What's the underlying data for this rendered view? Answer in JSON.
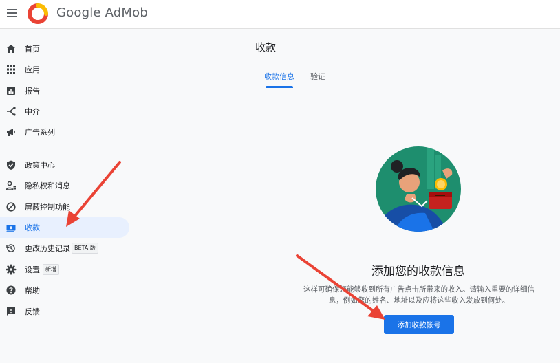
{
  "header": {
    "brand": "Google AdMob",
    "menu_icon": "hamburger-menu-icon",
    "logo_icon": "admob-logo-icon"
  },
  "sidebar": {
    "items": [
      {
        "label": "首页",
        "icon": "home-icon",
        "active": false
      },
      {
        "label": "应用",
        "icon": "apps-grid-icon",
        "active": false
      },
      {
        "label": "报告",
        "icon": "report-chart-icon",
        "active": false
      },
      {
        "label": "中介",
        "icon": "mediation-icon",
        "active": false
      },
      {
        "label": "广告系列",
        "icon": "megaphone-icon",
        "active": false
      },
      {
        "label": "政策中心",
        "icon": "shield-check-icon",
        "active": false
      },
      {
        "label": "隐私权和消息",
        "icon": "privacy-person-icon",
        "active": false
      },
      {
        "label": "屏蔽控制功能",
        "icon": "block-icon",
        "active": false
      },
      {
        "label": "收款",
        "icon": "payments-icon",
        "active": true
      },
      {
        "label": "更改历史记录",
        "icon": "history-icon",
        "active": false,
        "badge": "BETA 版"
      },
      {
        "label": "设置",
        "icon": "gear-icon",
        "active": false,
        "badge": "新增"
      },
      {
        "label": "帮助",
        "icon": "help-icon",
        "active": false
      },
      {
        "label": "反馈",
        "icon": "feedback-icon",
        "active": false
      }
    ]
  },
  "main": {
    "title": "收款",
    "tabs": [
      {
        "label": "收款信息",
        "active": true
      },
      {
        "label": "验证",
        "active": false
      }
    ],
    "empty_state": {
      "illustration": "woman-depositing-coin-illustration",
      "title": "添加您的收款信息",
      "description_line1": "这样可确保您能够收到所有广告点击所带来的收入。请输入重要的详细信",
      "description_line2": "息，例如您的姓名、地址以及应将这些收入发放到何处。",
      "button": "添加收款帐号"
    }
  },
  "colors": {
    "accent": "#1a73e8",
    "active_bg": "#e8f0fe",
    "annotation_arrow": "#ea4335"
  }
}
